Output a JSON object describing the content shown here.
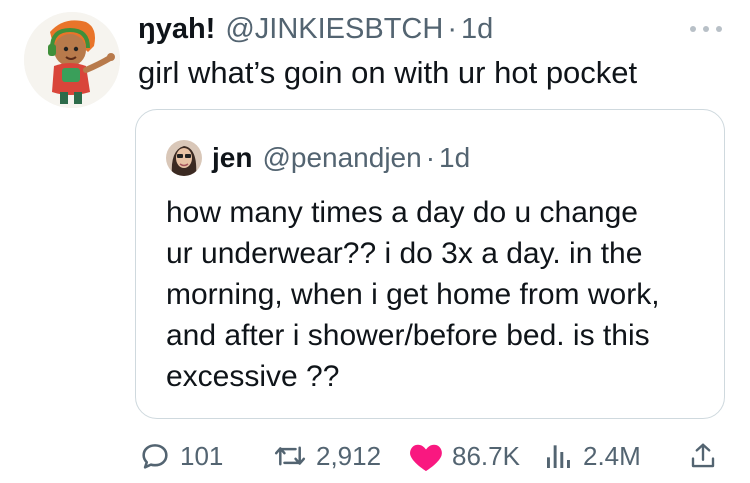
{
  "tweet": {
    "display_name": "ŋyah!",
    "handle": "@JINKIESBTCH",
    "separator": "·",
    "time": "1d",
    "text": "girl what’s goin on with ur hot pocket"
  },
  "quote": {
    "display_name": "jen",
    "handle": "@penandjen",
    "separator": "·",
    "time": "1d",
    "lines": [
      "how many times a day do u change",
      "ur underwear?? i do 3x a day. in the",
      "morning, when i get home from work,",
      "and after i shower/before bed. is this",
      "excessive ??"
    ]
  },
  "actions": {
    "replies": "101",
    "reposts": "2,912",
    "likes": "86.7K",
    "views": "2.4M"
  },
  "colors": {
    "text": "#0f1419",
    "secondary": "#536471",
    "border": "#cfd9de",
    "like": "#f91880"
  },
  "icons": [
    "avatar-cartoon",
    "more-icon",
    "reply-icon",
    "repost-icon",
    "like-heart-filled-icon",
    "views-icon",
    "share-icon"
  ]
}
